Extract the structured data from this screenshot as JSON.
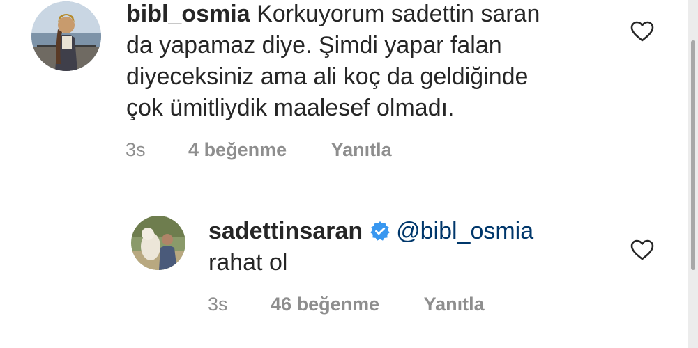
{
  "comments": [
    {
      "username": "bibl_osmia",
      "text_lines": [
        "Korkuyorum sadettin saran",
        "da yapamaz diye. Şimdi yapar falan",
        "diyeceksiniz ama ali koç da geldiğinde",
        "çok ümitliydik maalesef olmadı."
      ],
      "time": "3s",
      "likes": "4 beğenme",
      "reply": "Yanıtla",
      "like_icon": "heart-outline-icon"
    },
    {
      "username": "sadettinsaran",
      "verified": true,
      "mention": "@bibl_osmia",
      "text_lines": [
        "rahat ol"
      ],
      "time": "3s",
      "likes": "46 beğenme",
      "reply": "Yanıtla",
      "like_icon": "heart-outline-icon"
    }
  ],
  "colors": {
    "text": "#262626",
    "meta": "#8e8e8e",
    "mention": "#00376b",
    "verified": "#3897f0"
  }
}
